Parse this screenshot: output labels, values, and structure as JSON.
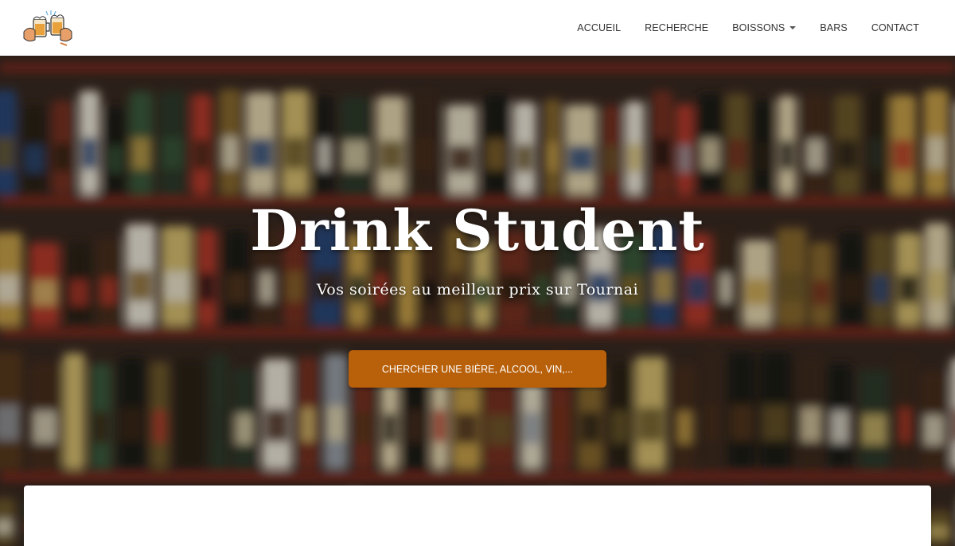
{
  "header": {
    "logo_name": "two-beer-mugs-toast-logo",
    "nav": [
      {
        "label": "ACCUEIL"
      },
      {
        "label": "RECHERCHE"
      },
      {
        "label": "BOISSONS",
        "has_dropdown": true
      },
      {
        "label": "BARS"
      },
      {
        "label": "CONTACT"
      }
    ]
  },
  "hero": {
    "title": "Drink Student",
    "subtitle": "Vos soirées au meilleur prix sur Tournai",
    "cta_label": "CHERCHER UNE BIÈRE, ALCOOL, VIN,...",
    "background": "blurred-beer-bottle-shelves"
  },
  "colors": {
    "accent": "#b8600a",
    "nav_text": "#333333",
    "hero_text": "#ffffff"
  }
}
